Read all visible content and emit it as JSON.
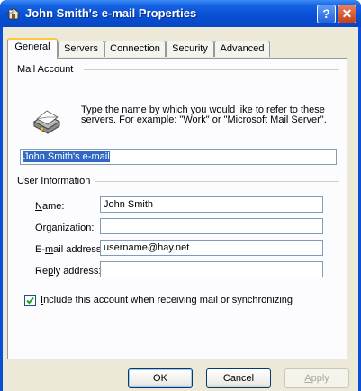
{
  "window": {
    "title": "John Smith's e-mail Properties",
    "help_label": "?",
    "close_label": "✕"
  },
  "tabs": [
    {
      "label": "General",
      "active": true
    },
    {
      "label": "Servers",
      "active": false
    },
    {
      "label": "Connection",
      "active": false
    },
    {
      "label": "Security",
      "active": false
    },
    {
      "label": "Advanced",
      "active": false
    }
  ],
  "mail_account": {
    "group_label": "Mail Account",
    "description": "Type the name by which you would like to refer to these servers.  For example: \"Work\" or \"Microsoft Mail Server\".",
    "account_name": "John Smith's e-mail",
    "icon": "mail-account-icon"
  },
  "user_information": {
    "group_label": "User Information",
    "name_label": "Name:",
    "name_value": "John Smith",
    "organization_label": "Organization:",
    "organization_value": "",
    "email_label": "E-mail address:",
    "email_value": "username@hay.net",
    "reply_label": "Reply address:",
    "reply_value": ""
  },
  "include_checkbox": {
    "label": "Include this account when receiving mail or synchronizing",
    "checked": true
  },
  "buttons": {
    "ok": "OK",
    "cancel": "Cancel",
    "apply": "Apply"
  },
  "colors": {
    "titlebar": "#0a4fd6",
    "dialog_face": "#ece9d8",
    "selection": "#316ac5",
    "close_button": "#c4401a"
  }
}
